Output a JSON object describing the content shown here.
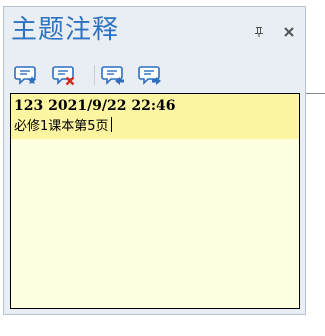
{
  "panel": {
    "title": "主题注释",
    "pin_icon": "pin-icon",
    "close_icon": "close-icon"
  },
  "toolbar": {
    "buttons": [
      {
        "name": "add-note-button",
        "icon": "comment-star-icon"
      },
      {
        "name": "delete-note-button",
        "icon": "comment-delete-icon"
      },
      {
        "name": "previous-note-button",
        "icon": "comment-previous-icon"
      },
      {
        "name": "next-note-button",
        "icon": "comment-next-icon"
      }
    ]
  },
  "note": {
    "header": "123 2021/9/22 22:46",
    "body": "必修1课本第5页"
  },
  "colors": {
    "title": "#2f73c0",
    "panel_bg": "#e9eef5",
    "editor_bg": "#ffffe1",
    "highlight_bg": "#fbf4a0",
    "icon_blue": "#2f6fbf",
    "delete_red": "#d62b1f"
  }
}
